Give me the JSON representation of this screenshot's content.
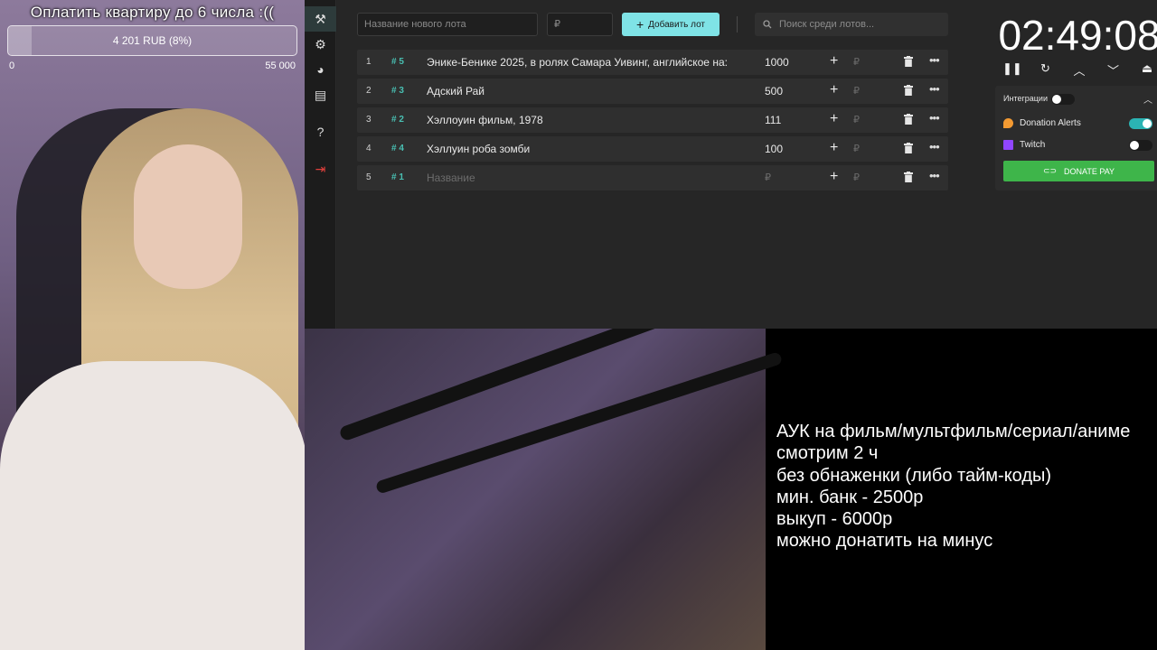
{
  "goal": {
    "title": "Оплатить квартиру до 6 числа :((",
    "amount": "4 201 RUB (8%)",
    "progress_percent": 8,
    "min": "0",
    "max": "55 000"
  },
  "sidebar": {
    "items": [
      {
        "icon": "gavel-icon",
        "glyph": "⚒"
      },
      {
        "icon": "gear-icon",
        "glyph": "⚙"
      },
      {
        "icon": "pie-chart-icon",
        "glyph": "◕"
      },
      {
        "icon": "clipboard-icon",
        "glyph": "▤"
      },
      {
        "icon": "help-icon",
        "glyph": "?"
      },
      {
        "icon": "logout-icon",
        "glyph": "⇥"
      }
    ]
  },
  "toolbar": {
    "new_lot_placeholder": "Название нового лота",
    "amount_placeholder": "₽",
    "add_label": "Добавить лот",
    "search_placeholder": "Поиск среди лотов..."
  },
  "lots": [
    {
      "num": "1",
      "tag": "# 5",
      "name": "Энике-Бенике 2025, в ролях Самара Уивинг, английское на:",
      "amount": "1000"
    },
    {
      "num": "2",
      "tag": "# 3",
      "name": "Адский Рай",
      "amount": "500"
    },
    {
      "num": "3",
      "tag": "# 2",
      "name": "Хэллоуин фильм, 1978",
      "amount": "111"
    },
    {
      "num": "4",
      "tag": "# 4",
      "name": "Хэллуин роба зомби",
      "amount": "100"
    },
    {
      "num": "5",
      "tag": "# 1",
      "name": "Название",
      "amount": "₽",
      "placeholder": true
    }
  ],
  "lot_actions": {
    "plus": "+",
    "currency": "₽",
    "more": "•••"
  },
  "timer": {
    "value": "02:49:08",
    "controls": [
      "pause-icon",
      "restart-icon",
      "chevron-up-icon",
      "chevron-down-icon",
      "eject-icon"
    ]
  },
  "integrations": {
    "title": "Интеграции",
    "master_on": false,
    "items": [
      {
        "label": "Donation Alerts",
        "on": true
      },
      {
        "label": "Twitch",
        "on": false
      }
    ],
    "donate_pay_label": "DONATE PAY"
  },
  "rules": [
    "АУК на фильм/мультфильм/сериал/аниме",
    "смотрим 2 ч",
    "без обнаженки (либо тайм-коды)",
    "мин. банк - 2500р",
    "выкуп - 6000р",
    "можно донатить на минус"
  ],
  "colors": {
    "accent": "#7fe3e6",
    "tag": "#49bfb2",
    "donate_pay": "#3eb54a",
    "toggle_on": "#2bb3b3",
    "twitch": "#9146ff",
    "donation_alerts": "#f39a32"
  }
}
